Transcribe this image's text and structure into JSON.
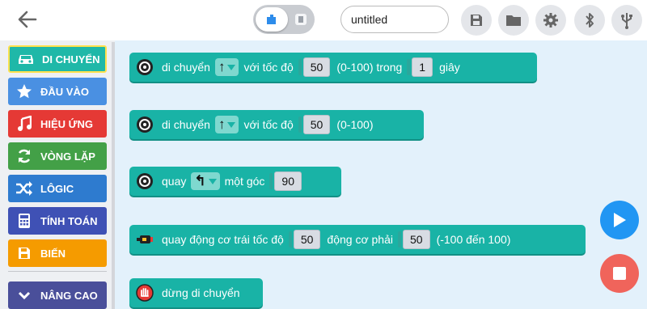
{
  "toolbar": {
    "project_name": "untitled",
    "icons": [
      "back-arrow-icon",
      "blocks-mode-icon",
      "python-mode-icon",
      "save-icon",
      "folder-icon",
      "gear-icon",
      "bluetooth-icon",
      "usb-icon"
    ]
  },
  "sidebar": {
    "items": [
      {
        "label": "DI CHUYỂN",
        "color": "#1fb8a8",
        "icon": "car-icon"
      },
      {
        "label": "ĐẦU VÀO",
        "color": "#4a90e2",
        "icon": "star-icon"
      },
      {
        "label": "HIỆU ỨNG",
        "color": "#e53935",
        "icon": "music-note-icon"
      },
      {
        "label": "VÒNG LẶP",
        "color": "#43a047",
        "icon": "refresh-icon"
      },
      {
        "label": "LÔGIC",
        "color": "#2e7bcf",
        "icon": "shuffle-icon"
      },
      {
        "label": "TÍNH TOÁN",
        "color": "#3f51b5",
        "icon": "calculator-icon"
      },
      {
        "label": "BIẾN",
        "color": "#f59b00",
        "icon": "save-icon"
      },
      {
        "label": "NÂNG CAO",
        "color": "#4a4f9a",
        "icon": "chevron-down-icon"
      }
    ]
  },
  "blocks": {
    "b1": {
      "t1": "di chuyển",
      "t2": "với tốc độ",
      "v1": "50",
      "t3": "(0-100) trong",
      "v2": "1",
      "t4": "giây",
      "arrow": "↑"
    },
    "b2": {
      "t1": "di chuyển",
      "t2": "với tốc độ",
      "v1": "50",
      "t3": "(0-100)",
      "arrow": "↑"
    },
    "b3": {
      "t1": "quay",
      "t2": "một góc",
      "v1": "90",
      "arrow": "↰"
    },
    "b4": {
      "t1": "quay động cơ trái tốc độ",
      "v1": "50",
      "t2": "động cơ phải",
      "v2": "50",
      "t3": "(-100 đến 100)"
    },
    "b5": {
      "t1": "dừng di chuyển"
    }
  },
  "colors": {
    "block": "#19b3a6",
    "workspace": "#e3f1fb",
    "run": "#2196f3",
    "stop": "#f0645b"
  }
}
